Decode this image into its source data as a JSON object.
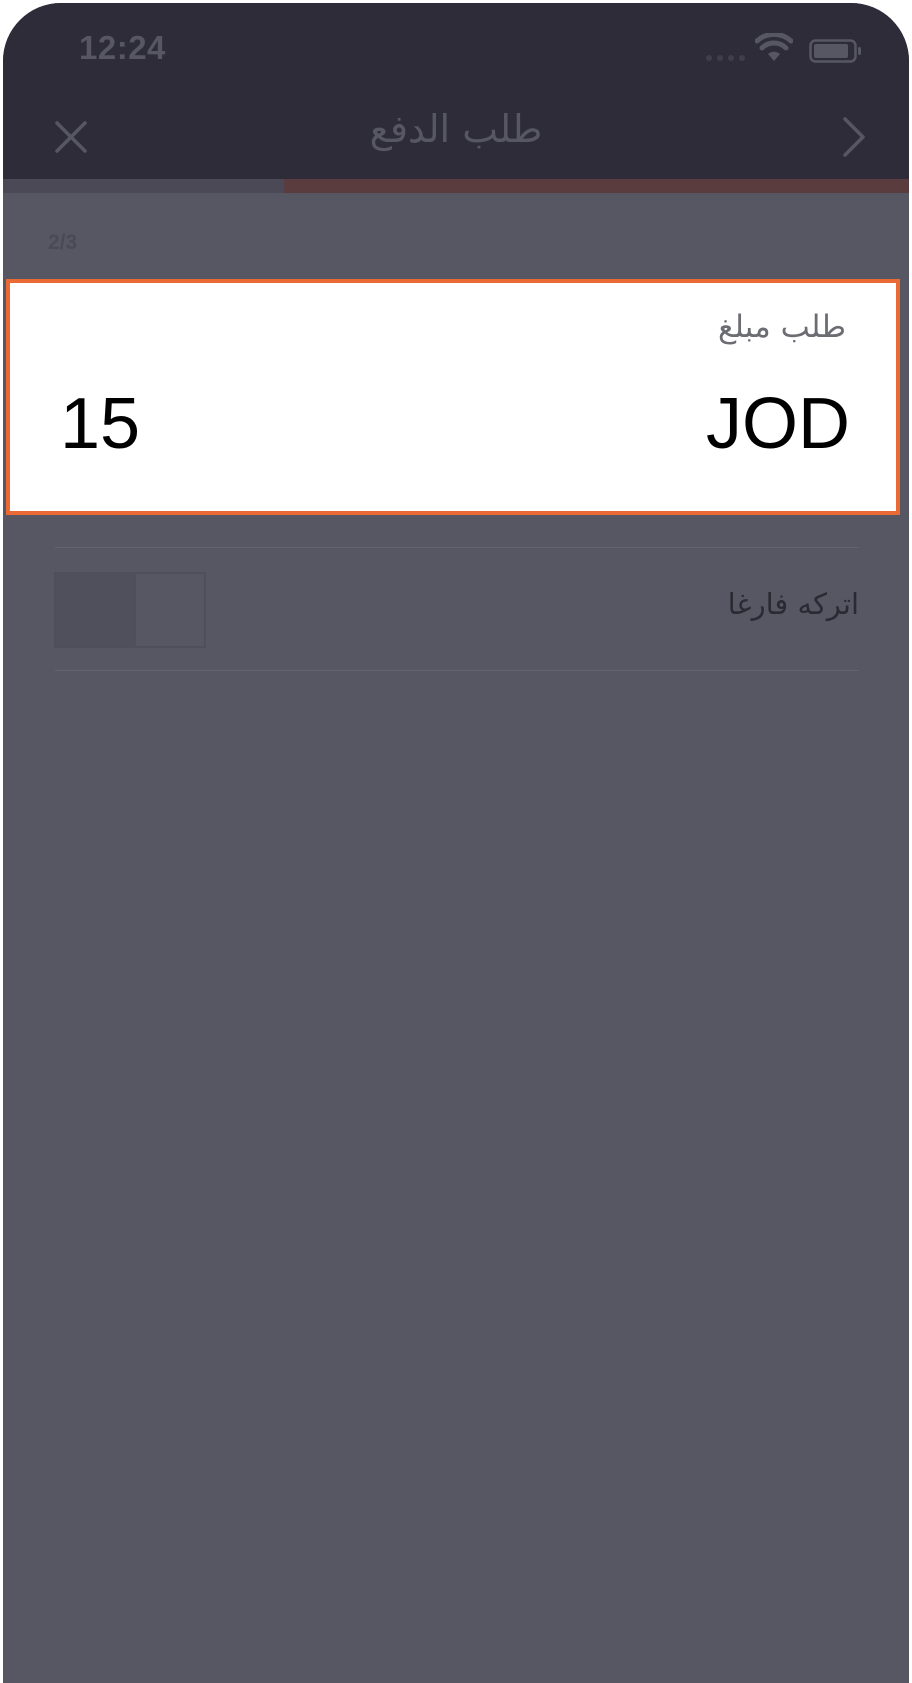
{
  "status_bar": {
    "time": "12:24",
    "signal_icon": "signal-dots-icon",
    "wifi_icon": "wifi-icon",
    "battery_icon": "battery-icon"
  },
  "nav": {
    "title": "طلب الدفع",
    "close_icon": "close-icon",
    "back_icon": "chevron-right-icon"
  },
  "progress": {
    "step_text": "2/3",
    "fraction": 0.69
  },
  "amount_card": {
    "label": "طلب مبلغ",
    "currency": "JOD",
    "value": "15",
    "highlight_color": "#ea6a36"
  },
  "leave_empty": {
    "label": "اتركه فارغا",
    "toggle_on": false
  },
  "colors": {
    "overlay": "#575764",
    "header": "#2d2c38",
    "accent": "#ea6a36"
  }
}
